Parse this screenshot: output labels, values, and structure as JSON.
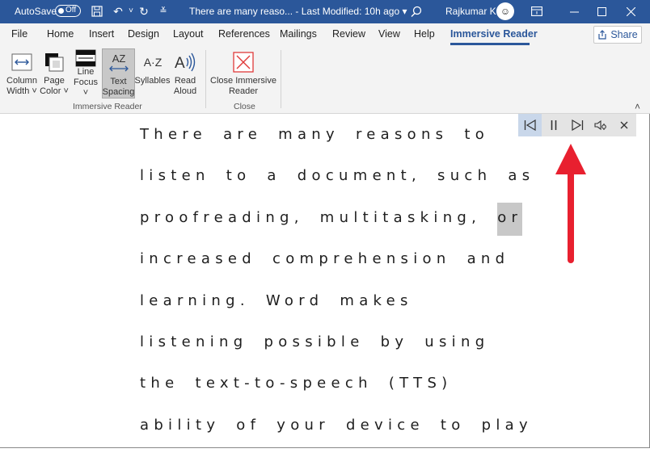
{
  "titlebar": {
    "autosave_label": "AutoSave",
    "autosave_state": "Off",
    "doc_title": "There are many reaso...  -  Last Modified: 10h ago  ▾",
    "user_name": "Rajkumar K",
    "icons": [
      "save-icon",
      "undo-icon",
      "redo-icon",
      "customize-qat-icon",
      "search-icon",
      "ribbon-display-icon",
      "minimize-icon",
      "maximize-icon",
      "close-icon"
    ]
  },
  "menu": {
    "items": [
      "File",
      "Home",
      "Insert",
      "Design",
      "Layout",
      "References",
      "Mailings",
      "Review",
      "View",
      "Help",
      "Immersive Reader"
    ],
    "active": "Immersive Reader",
    "share_label": "Share"
  },
  "ribbon": {
    "buttons": {
      "column_width": [
        "Column",
        "Width ˅"
      ],
      "page_color": [
        "Page",
        "Color ˅"
      ],
      "line_focus": [
        "Line",
        "Focus ˅"
      ],
      "text_spacing": [
        "Text",
        "Spacing"
      ],
      "syllables": "Syllables",
      "read_aloud": [
        "Read",
        "Aloud"
      ],
      "close_reader": [
        "Close Immersive",
        "Reader"
      ]
    },
    "groups": [
      "Immersive Reader",
      "Close"
    ]
  },
  "document": {
    "lines": [
      "There are many reasons to",
      "listen to a document, such as",
      "proofreading, multitasking,",
      "increased comprehension and",
      "learning. Word makes",
      "listening possible by using",
      "the text-to-speech (TTS)",
      "ability of your device to play"
    ],
    "highlighted_word": "or"
  },
  "colors": {
    "title_bar": "#2b579a",
    "arrow": "#e8202f",
    "highlight": "#c8c8c8"
  }
}
